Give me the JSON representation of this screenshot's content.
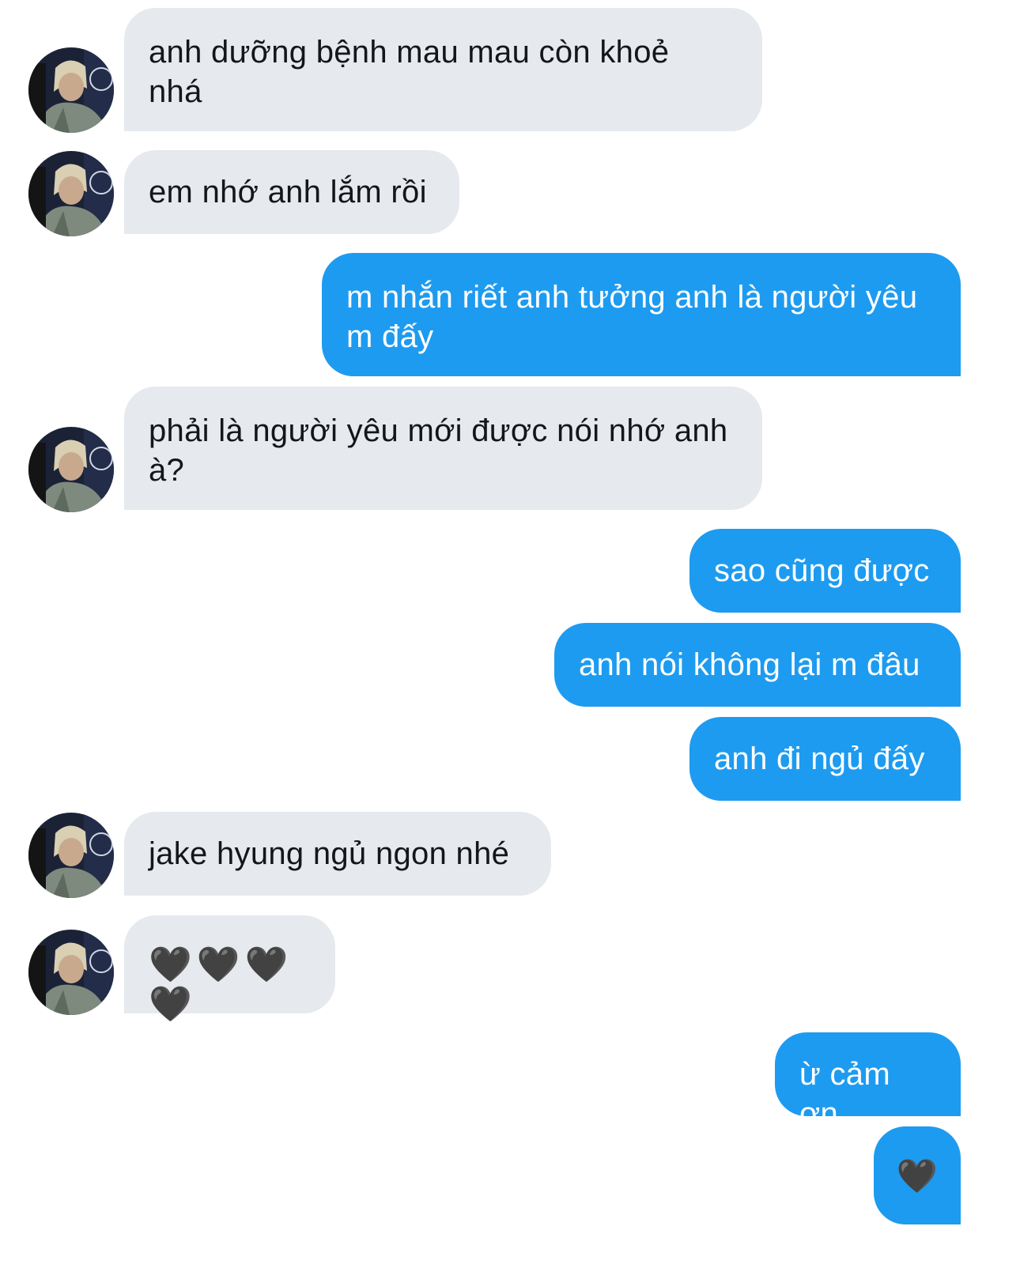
{
  "conversation": {
    "messages": [
      {
        "direction": "incoming",
        "text": "anh dưỡng bệnh mau mau còn khoẻ\nnhá",
        "avatar": "avatar-photo"
      },
      {
        "direction": "incoming",
        "text": "em nhớ anh lắm rồi",
        "avatar": "avatar-photo"
      },
      {
        "direction": "outgoing",
        "text": "m nhắn riết anh tưởng anh là người yêu\nm đấy"
      },
      {
        "direction": "incoming",
        "text": "phải là người yêu mới được nói nhớ anh\nà?",
        "avatar": "avatar-photo"
      },
      {
        "direction": "outgoing",
        "text": "sao cũng được"
      },
      {
        "direction": "outgoing",
        "text": "anh nói không lại m đâu"
      },
      {
        "direction": "outgoing",
        "text": "anh đi ngủ đấy"
      },
      {
        "direction": "incoming",
        "text": "jake hyung ngủ ngon nhé",
        "avatar": "avatar-photo"
      },
      {
        "direction": "incoming",
        "text": "🖤🖤🖤🖤",
        "avatar": "avatar-photo"
      },
      {
        "direction": "outgoing",
        "text": "ừ cảm ơn"
      },
      {
        "direction": "outgoing",
        "text": "🖤"
      }
    ]
  },
  "colors": {
    "incoming_bubble": "#e6e9ed",
    "outgoing_bubble": "#1d9bf0",
    "incoming_text": "#14171a",
    "outgoing_text": "#ffffff"
  }
}
